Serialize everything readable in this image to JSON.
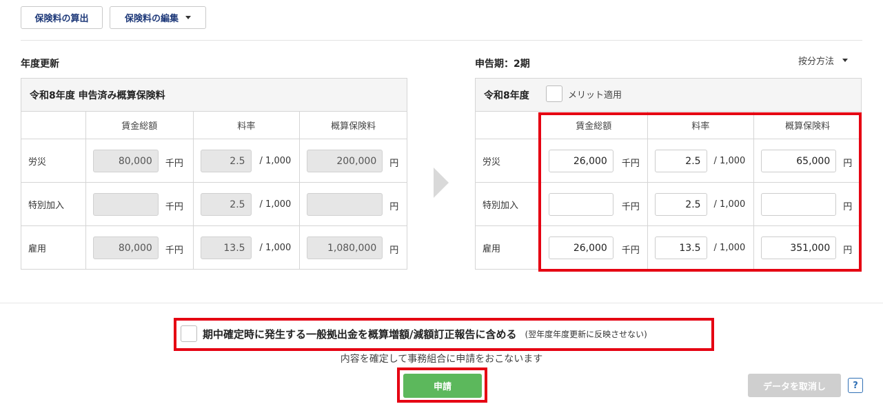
{
  "toolbar": {
    "calc_label": "保険料の算出",
    "edit_label": "保険料の編集"
  },
  "renewal": {
    "section_title": "年度更新",
    "table_title": "令和8年度 申告済み概算保険料",
    "headers": [
      "賃金総額",
      "料率",
      "概算保険料"
    ],
    "rows": [
      {
        "label": "労災",
        "wage": "80,000",
        "wage_unit": "千円",
        "rate": "2.5",
        "rate_unit": "/ 1,000",
        "premium": "200,000",
        "premium_unit": "円"
      },
      {
        "label": "特別加入",
        "wage": "",
        "wage_unit": "千円",
        "rate": "2.5",
        "rate_unit": "/ 1,000",
        "premium": "",
        "premium_unit": "円"
      },
      {
        "label": "雇用",
        "wage": "80,000",
        "wage_unit": "千円",
        "rate": "13.5",
        "rate_unit": "/ 1,000",
        "premium": "1,080,000",
        "premium_unit": "円"
      }
    ]
  },
  "declaration": {
    "section_title": "申告期：2期",
    "method_label": "按分方法",
    "table_title": "令和8年度",
    "merit_label": "メリット適用",
    "headers": [
      "賃金総額",
      "料率",
      "概算保険料"
    ],
    "rows": [
      {
        "label": "労災",
        "wage": "26,000",
        "wage_unit": "千円",
        "rate": "2.5",
        "rate_unit": "/ 1,000",
        "premium": "65,000",
        "premium_unit": "円"
      },
      {
        "label": "特別加入",
        "wage": "",
        "wage_unit": "千円",
        "rate": "2.5",
        "rate_unit": "/ 1,000",
        "premium": "",
        "premium_unit": "円"
      },
      {
        "label": "雇用",
        "wage": "26,000",
        "wage_unit": "千円",
        "rate": "13.5",
        "rate_unit": "/ 1,000",
        "premium": "351,000",
        "premium_unit": "円"
      }
    ]
  },
  "footer": {
    "include_label": "期中確定時に発生する一般拠出金を概算増額/減額訂正報告に含める",
    "include_note": "(翌年度年度更新に反映させない)",
    "confirm_text": "内容を確定して事務組合に申請をおこないます",
    "apply_label": "申請",
    "cancel_label": "データを取消し",
    "help_label": "?"
  },
  "colors": {
    "highlight": "#e50012",
    "apply": "#5cb85c",
    "link": "#1f3a7a"
  }
}
